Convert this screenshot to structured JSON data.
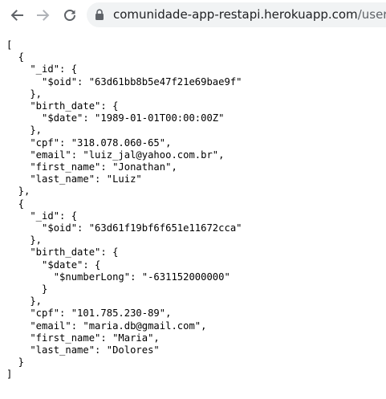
{
  "browser": {
    "url_host": "comunidade-app-restapi.herokuapp.com",
    "url_path": "/users"
  },
  "json_lines": [
    "[",
    "  {",
    "    \"_id\": {",
    "      \"$oid\": \"63d61bb8b5e47f21e69bae9f\"",
    "    },",
    "    \"birth_date\": {",
    "      \"$date\": \"1989-01-01T00:00:00Z\"",
    "    },",
    "    \"cpf\": \"318.078.060-65\",",
    "    \"email\": \"luiz_jal@yahoo.com.br\",",
    "    \"first_name\": \"Jonathan\",",
    "    \"last_name\": \"Luiz\"",
    "  },",
    "  {",
    "    \"_id\": {",
    "      \"$oid\": \"63d61f19bf6f651e11672cca\"",
    "    },",
    "    \"birth_date\": {",
    "      \"$date\": {",
    "        \"$numberLong\": \"-631152000000\"",
    "      }",
    "    },",
    "    \"cpf\": \"101.785.230-89\",",
    "    \"email\": \"maria.db@gmail.com\",",
    "    \"first_name\": \"Maria\",",
    "    \"last_name\": \"Dolores\"",
    "  }",
    "]"
  ]
}
